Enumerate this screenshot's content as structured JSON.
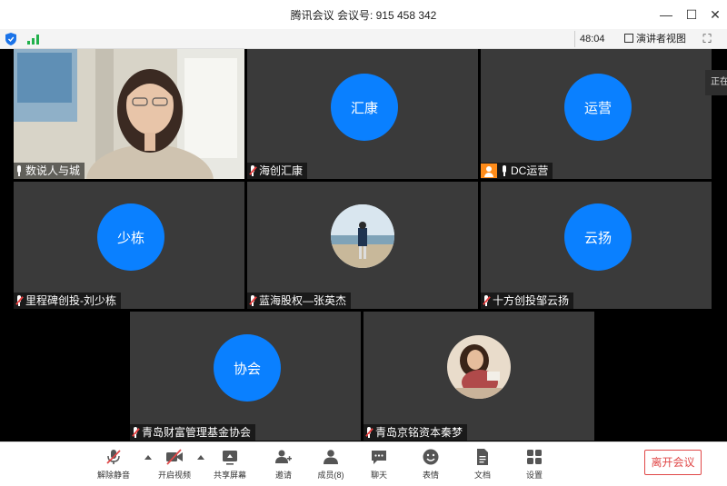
{
  "window": {
    "title": "腾讯会议 会议号: 915 458 342",
    "minimize": "—",
    "maximize": "☐",
    "close": "✕"
  },
  "statusbar": {
    "timer": "48:04",
    "speaker_view": "演讲者视图",
    "fullscreen_icon": "⛶"
  },
  "side_tab": "正在",
  "participants": [
    {
      "name": "数说人与城",
      "video": true,
      "mic": "on",
      "avatar_text": ""
    },
    {
      "name": "海创汇康",
      "video": false,
      "mic": "muted",
      "avatar_text": "汇康"
    },
    {
      "name": "DC运营",
      "video": false,
      "mic": "on",
      "avatar_text": "运营",
      "badge": "person-icon"
    },
    {
      "name": "里程碑创投-刘少栋",
      "video": false,
      "mic": "muted",
      "avatar_text": "少栋"
    },
    {
      "name": "蓝海股权—张英杰",
      "video": false,
      "mic": "muted",
      "avatar_text": "",
      "photo": true
    },
    {
      "name": "十方创投邹云扬",
      "video": false,
      "mic": "muted",
      "avatar_text": "云扬"
    },
    {
      "name": "青岛财富管理基金协会",
      "video": false,
      "mic": "muted",
      "avatar_text": "协会"
    },
    {
      "name": "青岛京铭资本秦梦",
      "video": false,
      "mic": "muted",
      "avatar_text": "",
      "photo": true
    }
  ],
  "toolbar": {
    "unmute": "解除静音",
    "start_video": "开启视频",
    "share_screen": "共享屏幕",
    "invite": "邀请",
    "members": "成员(8)",
    "chat": "聊天",
    "reactions": "表情",
    "documents": "文档",
    "settings": "设置",
    "leave": "离开会议"
  },
  "colors": {
    "avatar_blue": "#0a80ff",
    "tile_bg": "#3a3a3a",
    "leave_red": "#e04848",
    "badge_orange": "#ff8c1a"
  }
}
